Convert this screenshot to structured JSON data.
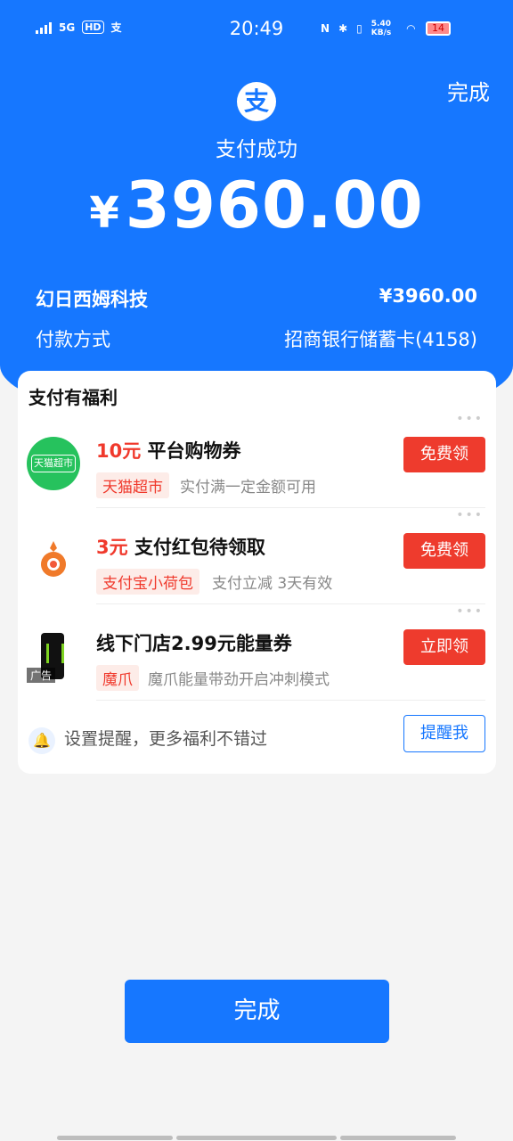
{
  "status_bar": {
    "network": "5G",
    "hd": "HD",
    "time": "20:49",
    "speed": "5.40 KB/s",
    "battery": "14"
  },
  "header": {
    "done_label": "完成",
    "logo_char": "支",
    "title": "支付成功",
    "currency": "¥",
    "amount": "3960.00"
  },
  "details": {
    "merchant": "幻日西姆科技",
    "merchant_amount": "¥3960.00",
    "method_label": "付款方式",
    "method_value": "招商银行储蓄卡(4158)"
  },
  "benefits": {
    "title": "支付有福利",
    "offers": [
      {
        "value": "10元",
        "name": "平台购物券",
        "tag": "天猫超市",
        "desc": "实付满一定金额可用",
        "button": "免费领",
        "icon_text": "天猫超市"
      },
      {
        "value": "3元",
        "name": "支付红包待领取",
        "tag": "支付宝小荷包",
        "desc": "支付立减 3天有效",
        "button": "免费领"
      },
      {
        "value": "",
        "name": "线下门店2.99元能量券",
        "tag": "魔爪",
        "desc": "魔爪能量带劲开启冲刺模式",
        "button": "立即领",
        "ad_label": "广告"
      }
    ],
    "reminder_text": "设置提醒，更多福利不错过",
    "reminder_button": "提醒我"
  },
  "footer": {
    "done_label": "完成"
  },
  "colors": {
    "brand_blue": "#1677ff",
    "offer_red": "#ee3b2d"
  }
}
